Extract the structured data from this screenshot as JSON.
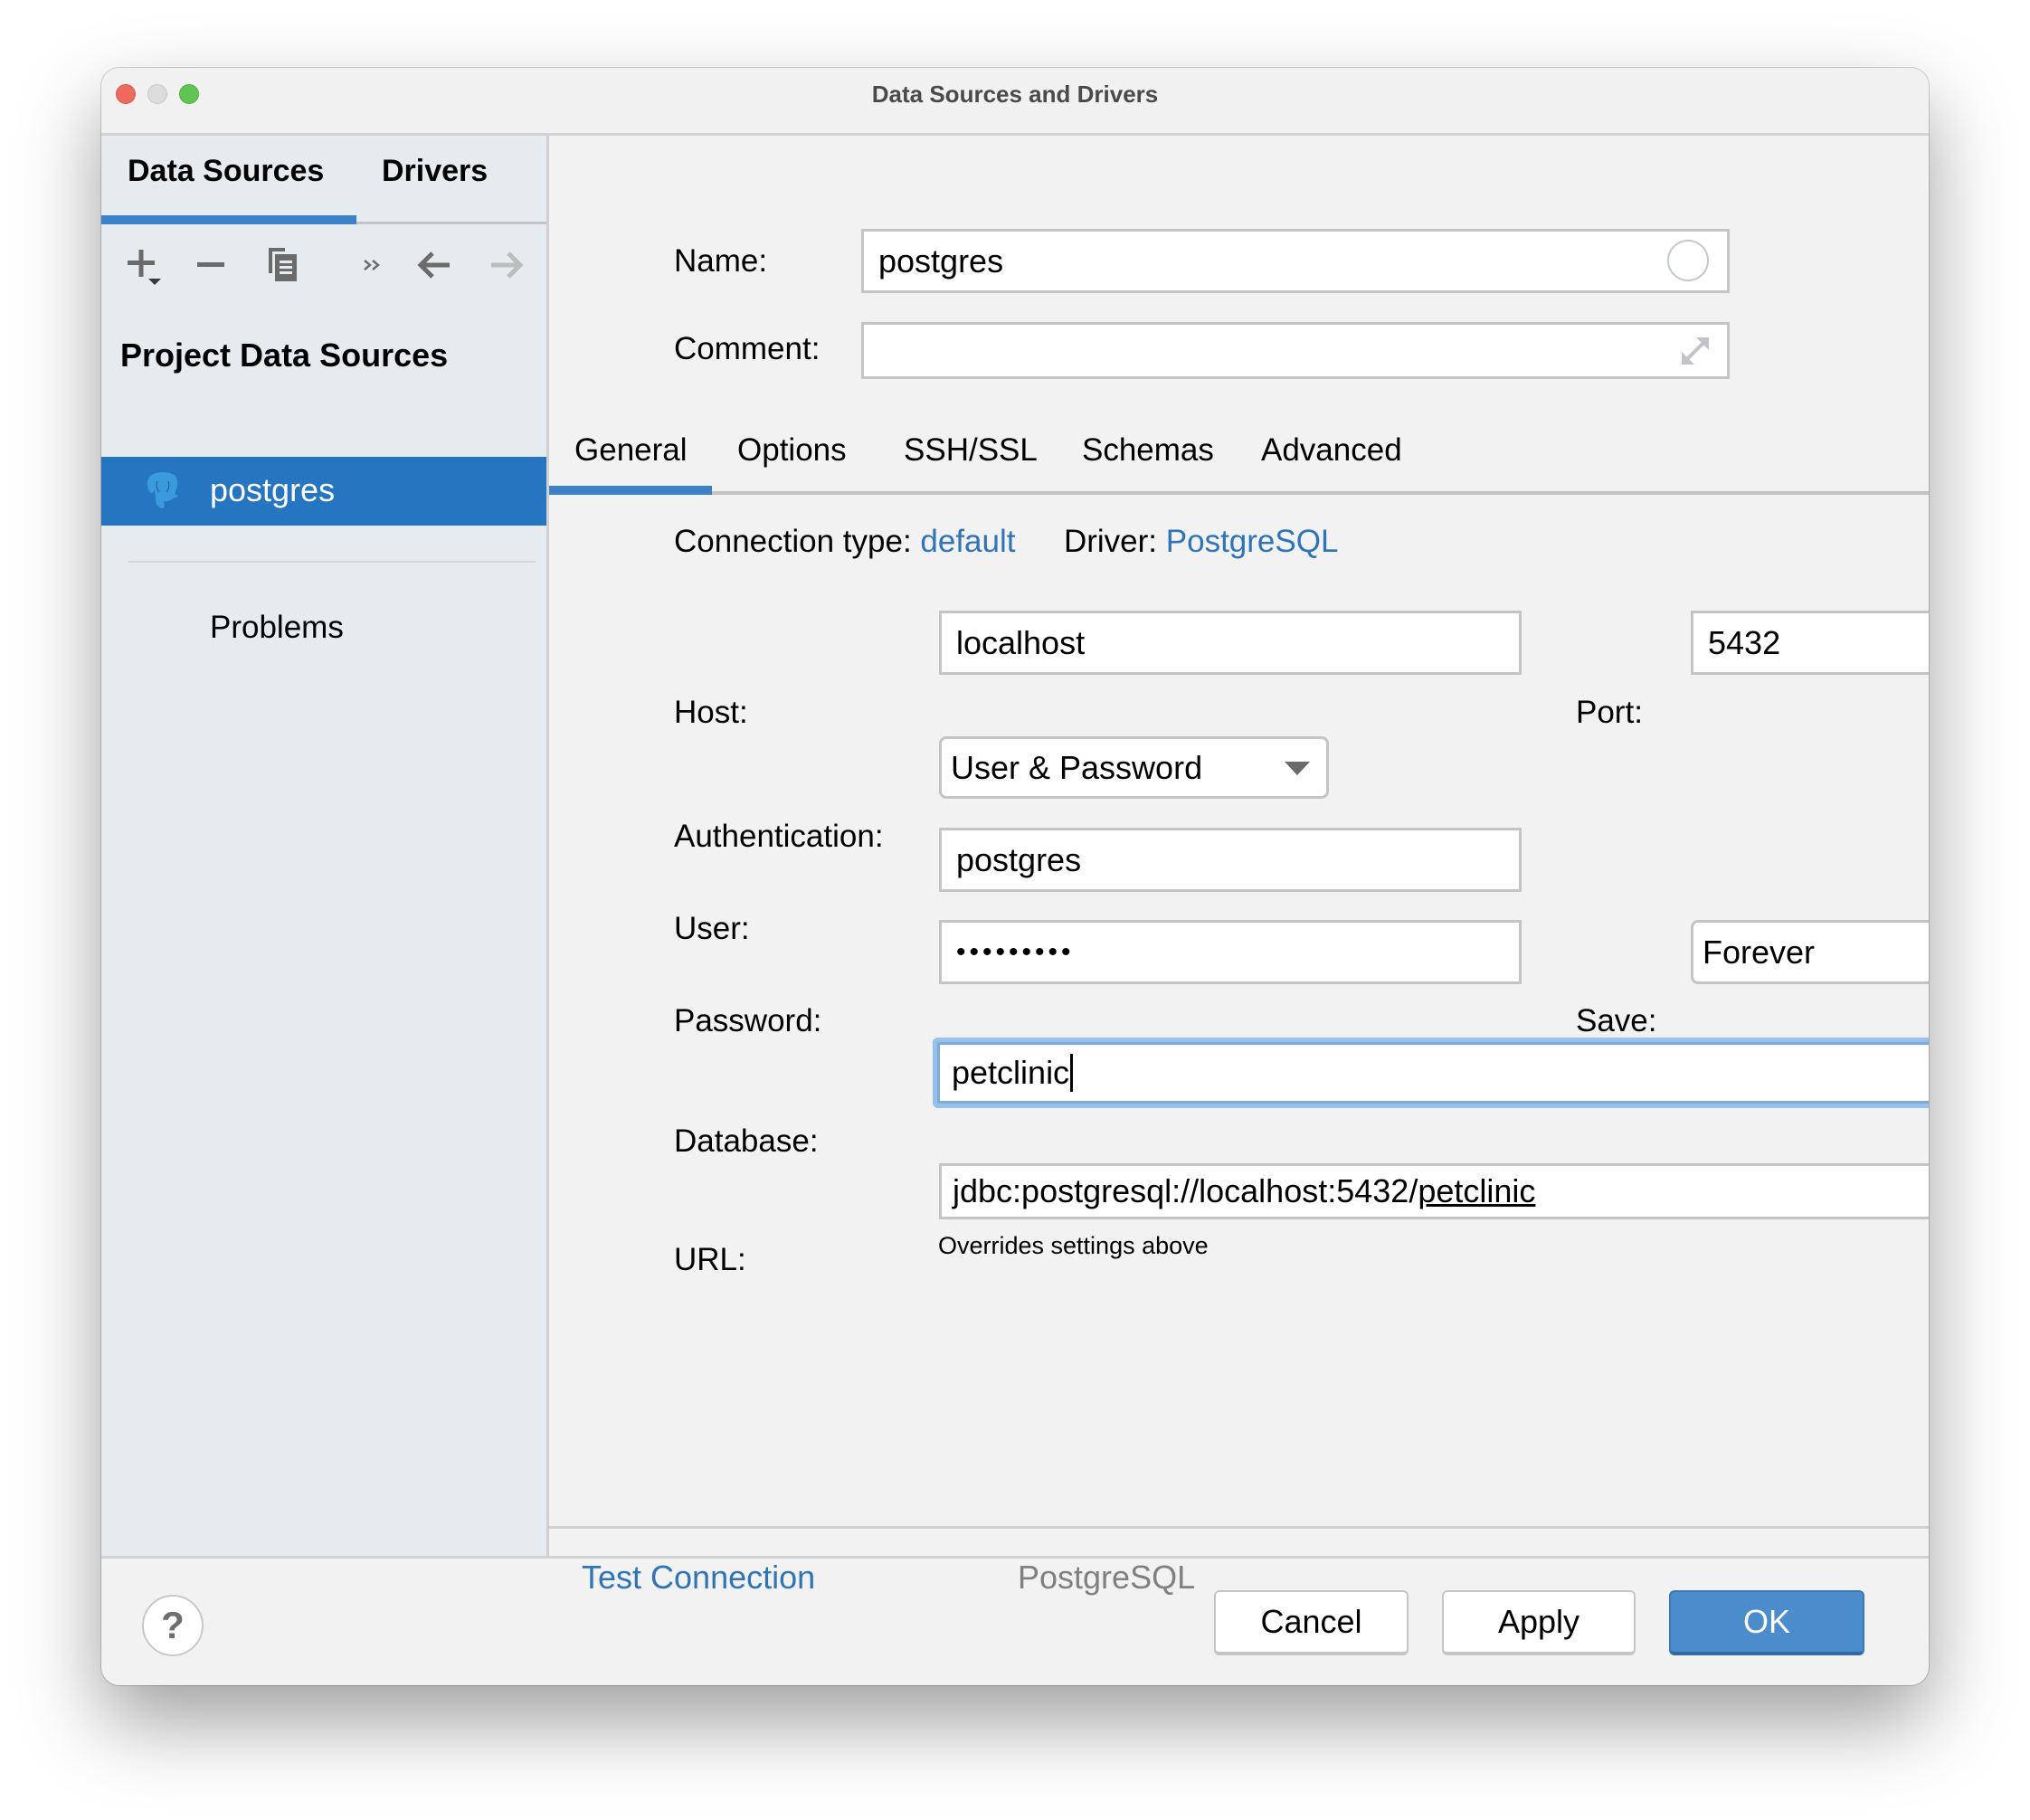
{
  "window": {
    "title": "Data Sources and Drivers"
  },
  "sidebar": {
    "tabs": [
      {
        "label": "Data Sources",
        "active": true
      },
      {
        "label": "Drivers",
        "active": false
      }
    ],
    "toolbar": [
      {
        "icon": "add-icon"
      },
      {
        "icon": "remove-icon"
      },
      {
        "icon": "duplicate-icon"
      },
      {
        "icon": "more-icon"
      },
      {
        "icon": "back-arrow-icon"
      },
      {
        "icon": "forward-arrow-icon"
      }
    ],
    "section_title": "Project Data Sources",
    "items": [
      {
        "label": "postgres",
        "icon": "postgresql-elephant-icon",
        "selected": true
      }
    ],
    "problems_label": "Problems"
  },
  "form": {
    "name_label": "Name:",
    "name_value": "postgres",
    "comment_label": "Comment:",
    "comment_value": "",
    "tabs": [
      {
        "label": "General",
        "active": true
      },
      {
        "label": "Options",
        "active": false
      },
      {
        "label": "SSH/SSL",
        "active": false
      },
      {
        "label": "Schemas",
        "active": false
      },
      {
        "label": "Advanced",
        "active": false
      }
    ],
    "connection_type_label": "Connection type:",
    "connection_type_value": "default",
    "driver_label": "Driver:",
    "driver_value": "PostgreSQL",
    "host_label": "Host:",
    "host_value": "localhost",
    "port_label": "Port:",
    "port_value": "5432",
    "auth_label": "Authentication:",
    "auth_value": "User & Password",
    "user_label": "User:",
    "user_value": "postgres",
    "password_label": "Password:",
    "password_masked": "•••••••••",
    "save_label": "Save:",
    "save_value": "Forever",
    "database_label": "Database:",
    "database_value": "petclinic",
    "url_label": "URL:",
    "url_prefix": "jdbc:postgresql://localhost:5432/",
    "url_db": "petclinic",
    "url_hint": "Overrides settings above"
  },
  "bottom": {
    "test_connection": "Test Connection",
    "driver_name": "PostgreSQL"
  },
  "footer": {
    "help": "?",
    "cancel": "Cancel",
    "apply": "Apply",
    "ok": "OK"
  },
  "colors": {
    "accent": "#2675c0",
    "link": "#2f73b8",
    "primary_button": "#4b8ccc",
    "sidebar_bg": "#e6ebf0",
    "focus_ring": "#96c0ee"
  }
}
